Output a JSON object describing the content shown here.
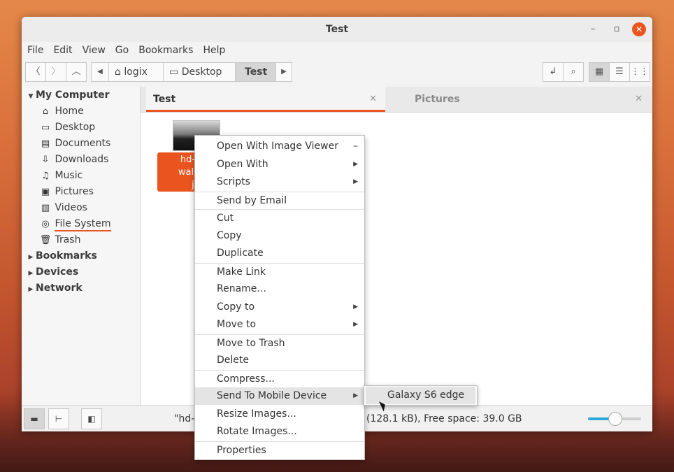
{
  "window": {
    "title": "Test"
  },
  "menubar": [
    "File",
    "Edit",
    "View",
    "Go",
    "Bookmarks",
    "Help"
  ],
  "breadcrumbs": [
    "logix",
    "Desktop",
    "Test"
  ],
  "sidebar": {
    "sections": [
      {
        "label": "My Computer",
        "expanded": true,
        "items": [
          {
            "label": "Home",
            "icon": "home-icon"
          },
          {
            "label": "Desktop",
            "icon": "desktop-icon"
          },
          {
            "label": "Documents",
            "icon": "documents-icon"
          },
          {
            "label": "Downloads",
            "icon": "downloads-icon"
          },
          {
            "label": "Music",
            "icon": "music-icon"
          },
          {
            "label": "Pictures",
            "icon": "pictures-icon"
          },
          {
            "label": "Videos",
            "icon": "videos-icon"
          },
          {
            "label": "File System",
            "icon": "filesystem-icon"
          },
          {
            "label": "Trash",
            "icon": "trash-icon"
          }
        ]
      },
      {
        "label": "Bookmarks",
        "expanded": false
      },
      {
        "label": "Devices",
        "expanded": false
      },
      {
        "label": "Network",
        "expanded": false
      }
    ]
  },
  "tabs": [
    {
      "label": "Test",
      "active": true
    },
    {
      "label": "Pictures",
      "active": false
    }
  ],
  "file": {
    "name_lines": [
      "hd-abs",
      "wallpap",
      "jp"
    ]
  },
  "context_menu": [
    {
      "label": "Open With Image Viewer",
      "suffix": "dash"
    },
    {
      "label": "Open With",
      "submenu": true
    },
    {
      "label": "Scripts",
      "submenu": true
    },
    {
      "label": "Send by Email",
      "sep": true
    },
    {
      "label": "Cut",
      "sep": true
    },
    {
      "label": "Copy"
    },
    {
      "label": "Duplicate"
    },
    {
      "label": "Make Link",
      "sep": true
    },
    {
      "label": "Rename..."
    },
    {
      "label": "Copy to",
      "submenu": true
    },
    {
      "label": "Move to",
      "submenu": true
    },
    {
      "label": "Move to Trash",
      "sep": true
    },
    {
      "label": "Delete"
    },
    {
      "label": "Compress...",
      "sep": true
    },
    {
      "label": "Send To Mobile Device",
      "submenu": true,
      "hover": true
    },
    {
      "label": "Resize Images..."
    },
    {
      "label": "Rotate Images..."
    },
    {
      "label": "Properties",
      "sep": true
    }
  ],
  "submenu": {
    "label": "Galaxy S6 edge"
  },
  "status": {
    "left": "\"hd-a",
    "right": "(128.1 kB), Free space: 39.0 GB"
  },
  "zoom": {
    "level": 0.5
  },
  "colors": {
    "accent": "#e9541f",
    "slider": "#2ea8d8"
  }
}
